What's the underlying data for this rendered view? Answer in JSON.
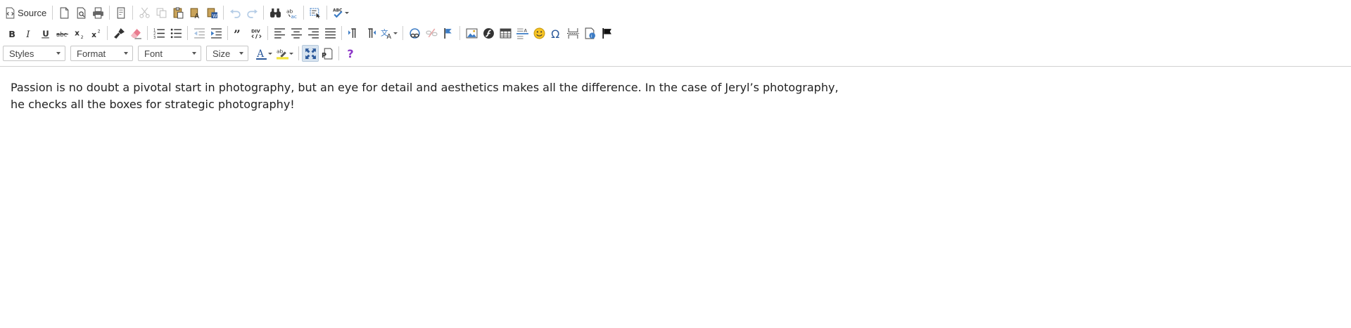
{
  "toolbar": {
    "source_label": "Source",
    "styles_label": "Styles",
    "format_label": "Format",
    "font_label": "Font",
    "size_label": "Size",
    "help_label": "?"
  },
  "colors": {
    "icon_dark": "#333333",
    "icon_blue": "#3b7bc4",
    "icon_gold": "#d9a520",
    "active_bg": "#d7e3ef"
  },
  "content": {
    "paragraph": "Passion is no doubt a pivotal start in photography, but an eye for detail and aesthetics makes all the difference. In the case of Jeryl’s photography, he checks all the boxes for strategic photography!"
  }
}
